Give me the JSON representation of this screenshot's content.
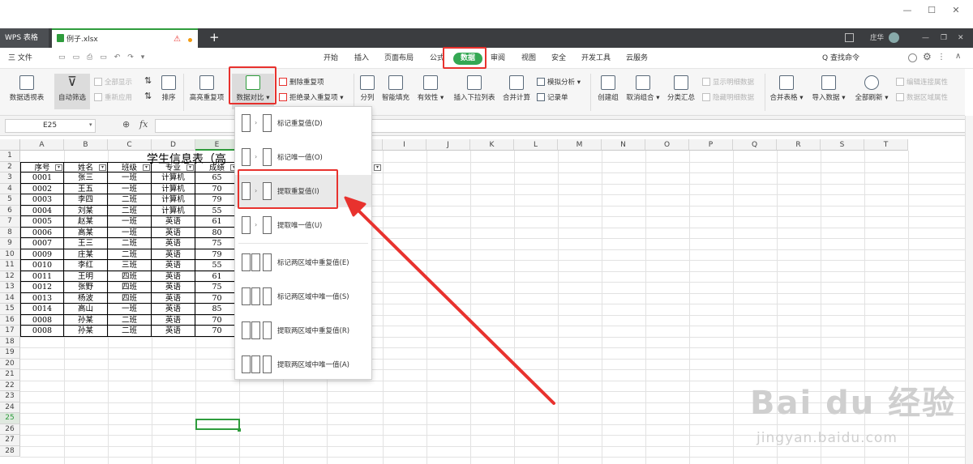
{
  "window": {
    "minimize_glyph": "—",
    "restore_glyph": "☐",
    "close_glyph": "✕"
  },
  "tabs": {
    "app": "WPS 表格",
    "file": "例子.xlsx",
    "warn": "⚠",
    "new_tab": "+"
  },
  "user": {
    "name": "庄华"
  },
  "menu": {
    "file": "三 文件",
    "items": [
      "开始",
      "插入",
      "页面布局",
      "公式",
      "数据",
      "审阅",
      "视图",
      "安全",
      "开发工具",
      "云服务"
    ],
    "search": "Q 查找命令"
  },
  "ribbon": {
    "pivot": "数据透视表",
    "autofilter": "自动筛选",
    "show_all": "全部显示",
    "reapply": "重新应用",
    "sort": "排序",
    "highlight_dup": "高亮重复项",
    "compare": "数据对比",
    "remove_dup": "删除重复项",
    "reject_dup": "拒绝录入重复项",
    "split": "分列",
    "smart_fill": "智能填充",
    "validity": "有效性",
    "insert_dropdown": "插入下拉列表",
    "consolidate": "合并计算",
    "what_if": "模拟分析",
    "record": "记录单",
    "group": "创建组",
    "ungroup": "取消组合",
    "subtotal": "分类汇总",
    "show_detail": "显示明细数据",
    "hide_detail": "隐藏明细数据",
    "merge_tables": "合并表格",
    "import": "导入数据",
    "refresh_all": "全部刷新",
    "edit_links": "编辑连接属性",
    "range_props": "数据区域属性"
  },
  "formula_bar": {
    "cell_ref": "E25",
    "fx": "fx",
    "value": ""
  },
  "columns": [
    "A",
    "B",
    "C",
    "D",
    "E",
    "F",
    "G",
    "H",
    "I",
    "J",
    "K",
    "L",
    "M",
    "N",
    "O",
    "P",
    "Q",
    "R",
    "S",
    "T"
  ],
  "rows": [
    "1",
    "2",
    "3",
    "4",
    "5",
    "6",
    "7",
    "8",
    "9",
    "10",
    "11",
    "12",
    "13",
    "14",
    "15",
    "16",
    "17",
    "18",
    "19",
    "20",
    "21",
    "22",
    "23",
    "24",
    "25",
    "26",
    "27",
    "28"
  ],
  "sheet": {
    "title": "学生信息表（高",
    "headers": [
      "序号",
      "姓名",
      "班级",
      "专业",
      "成绩"
    ],
    "data": [
      [
        "0001",
        "张三",
        "一班",
        "计算机",
        "65"
      ],
      [
        "0002",
        "王五",
        "一班",
        "计算机",
        "70"
      ],
      [
        "0003",
        "李四",
        "二班",
        "计算机",
        "79"
      ],
      [
        "0004",
        "刘某",
        "二班",
        "计算机",
        "55"
      ],
      [
        "0005",
        "赵某",
        "一班",
        "英语",
        "61"
      ],
      [
        "0006",
        "高某",
        "一班",
        "英语",
        "80"
      ],
      [
        "0007",
        "王三",
        "二班",
        "英语",
        "75"
      ],
      [
        "0009",
        "庄某",
        "二班",
        "英语",
        "79"
      ],
      [
        "0010",
        "李红",
        "三班",
        "英语",
        "55"
      ],
      [
        "0011",
        "王明",
        "四班",
        "英语",
        "61"
      ],
      [
        "0012",
        "张野",
        "四班",
        "英语",
        "75"
      ],
      [
        "0013",
        "杨波",
        "四班",
        "英语",
        "70"
      ],
      [
        "0014",
        "高山",
        "一班",
        "英语",
        "85"
      ],
      [
        "0008",
        "孙某",
        "二班",
        "英语",
        "70"
      ],
      [
        "0008",
        "孙某",
        "二班",
        "英语",
        "70"
      ]
    ]
  },
  "dropdown": {
    "items": [
      "标记重复值(D)",
      "标记唯一值(O)",
      "提取重复值(I)",
      "提取唯一值(U)",
      "标记两区域中重复值(E)",
      "标记两区域中唯一值(S)",
      "提取两区域中重复值(R)",
      "提取两区域中唯一值(A)"
    ]
  },
  "watermark": {
    "brand": "Bai du 经验",
    "url": "jingyan.baidu.com"
  },
  "colors": {
    "accent": "#34a853",
    "highlight": "#e8322e",
    "tabbar": "#3b3d40"
  }
}
